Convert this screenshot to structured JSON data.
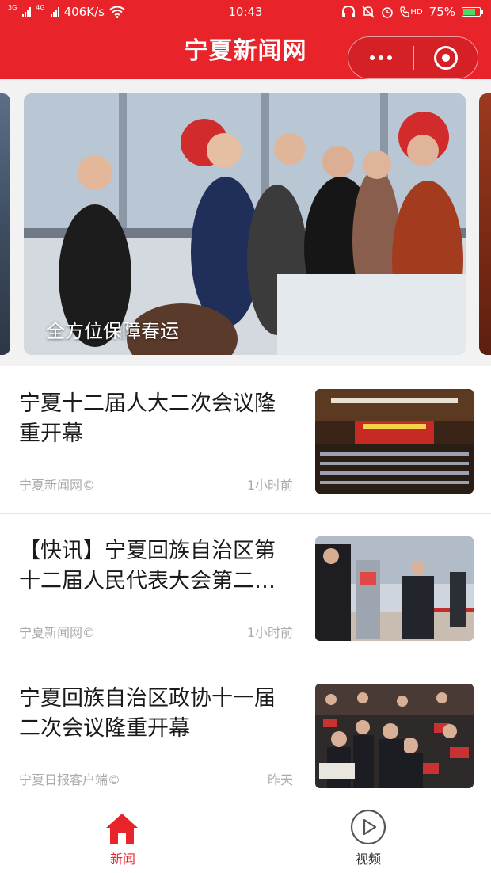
{
  "status_bar": {
    "net1": "3G",
    "net2": "4G",
    "speed": "406K/s",
    "time": "10:43",
    "hd": "HD",
    "battery": "75%",
    "battery_level": 0.75
  },
  "header": {
    "title": "宁夏新闻网"
  },
  "carousel": {
    "caption": "全方位保障春运"
  },
  "news": [
    {
      "title": "宁夏十二届人大二次会议隆重开幕",
      "source": "宁夏新闻网©",
      "time": "1小时前"
    },
    {
      "title": "【快讯】宁夏回族自治区第十二届人民代表大会第二次会议开幕",
      "source": "宁夏新闻网©",
      "time": "1小时前"
    },
    {
      "title": "宁夏回族自治区政协十一届二次会议隆重开幕",
      "source": "宁夏日报客户端©",
      "time": "昨天"
    }
  ],
  "tabbar": {
    "news_label": "新闻",
    "video_label": "视频"
  },
  "colors": {
    "brand": "#e8242a",
    "muted_text": "#aaaaaa"
  },
  "icons": {
    "home": "home-icon",
    "play": "play-circle-icon",
    "more": "more-dots-icon",
    "close": "target-close-icon"
  }
}
